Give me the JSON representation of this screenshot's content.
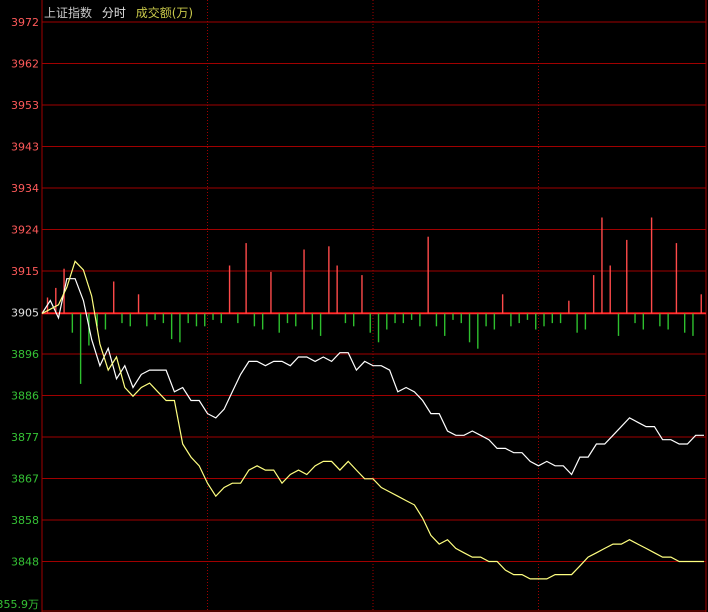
{
  "header": {
    "index_name": "上证指数",
    "chart_mode": "分时",
    "volume_label": "成交额(万)"
  },
  "colors": {
    "grid": "#a00000",
    "axis_label": "#ff5a5a",
    "axis_label_low": "#35c235",
    "price_line": "#ffffff",
    "avg_line": "#ffff80",
    "up_bar": "#ff4a4a",
    "down_bar": "#2ec02e",
    "title_text": "#c8c8c8",
    "volume_label_text": "#c9c94a"
  },
  "chart_data": {
    "type": "line",
    "title": "上证指数",
    "y_ticks": [
      "3972",
      "3962",
      "3953",
      "3943",
      "3934",
      "3924",
      "3915",
      "3905",
      "3896",
      "3886",
      "3877",
      "3867",
      "3858",
      "3848"
    ],
    "y_unit_label": "355.9万",
    "ylim": [
      3843.0,
      3974.0
    ],
    "reference_price": 3905,
    "x_range": [
      0,
      240
    ],
    "series": [
      {
        "key": "price",
        "x": [
          0,
          3,
          6,
          9,
          12,
          15,
          18,
          21,
          24,
          27,
          30,
          33,
          36,
          39,
          42,
          45,
          48,
          51,
          54,
          57,
          60,
          63,
          66,
          69,
          72,
          75,
          78,
          81,
          84,
          87,
          90,
          93,
          96,
          99,
          102,
          105,
          108,
          111,
          114,
          117,
          120,
          123,
          126,
          129,
          132,
          135,
          138,
          141,
          144,
          147,
          150,
          153,
          156,
          159,
          162,
          165,
          168,
          171,
          174,
          177,
          180,
          183,
          186,
          189,
          192,
          195,
          198,
          201,
          204,
          207,
          210,
          213,
          216,
          219,
          222,
          225,
          228,
          231,
          234,
          237,
          240
        ],
        "y": [
          3905,
          3908,
          3904,
          3913,
          3913,
          3908,
          3899,
          3893,
          3897,
          3890,
          3893,
          3888,
          3891,
          3892,
          3892,
          3892,
          3887,
          3888,
          3885,
          3885,
          3882,
          3881,
          3883,
          3887,
          3891,
          3894,
          3894,
          3893,
          3894,
          3894,
          3893,
          3895,
          3895,
          3894,
          3895,
          3894,
          3896,
          3896,
          3892,
          3894,
          3893,
          3893,
          3892,
          3887,
          3888,
          3887,
          3885,
          3882,
          3882,
          3878,
          3877,
          3877,
          3878,
          3877,
          3876,
          3874,
          3874,
          3873,
          3873,
          3871,
          3870,
          3871,
          3870,
          3870,
          3868,
          3872,
          3872,
          3875,
          3875,
          3877,
          3879,
          3881,
          3880,
          3879,
          3879,
          3876,
          3876,
          3875,
          3875,
          3877,
          3877
        ]
      },
      {
        "key": "average",
        "x": [
          0,
          3,
          6,
          9,
          12,
          15,
          18,
          21,
          24,
          27,
          30,
          33,
          36,
          39,
          42,
          45,
          48,
          51,
          54,
          57,
          60,
          63,
          66,
          69,
          72,
          75,
          78,
          81,
          84,
          87,
          90,
          93,
          96,
          99,
          102,
          105,
          108,
          111,
          114,
          117,
          120,
          123,
          126,
          129,
          132,
          135,
          138,
          141,
          144,
          147,
          150,
          153,
          156,
          159,
          162,
          165,
          168,
          171,
          174,
          177,
          180,
          183,
          186,
          189,
          192,
          195,
          198,
          201,
          204,
          207,
          210,
          213,
          216,
          219,
          222,
          225,
          228,
          231,
          234,
          237,
          240
        ],
        "y": [
          3905,
          3906,
          3907,
          3911,
          3917,
          3915,
          3909,
          3898,
          3892,
          3895,
          3888,
          3886,
          3888,
          3889,
          3887,
          3885,
          3885,
          3875,
          3872,
          3870,
          3866,
          3863,
          3865,
          3866,
          3866,
          3869,
          3870,
          3869,
          3869,
          3866,
          3868,
          3869,
          3868,
          3870,
          3871,
          3871,
          3869,
          3871,
          3869,
          3867,
          3867,
          3865,
          3864,
          3863,
          3862,
          3861,
          3858,
          3854,
          3852,
          3853,
          3851,
          3850,
          3849,
          3849,
          3848,
          3848,
          3846,
          3845,
          3845,
          3844,
          3844,
          3844,
          3845,
          3845,
          3845,
          3847,
          3849,
          3850,
          3851,
          3852,
          3852,
          3853,
          3852,
          3851,
          3850,
          3849,
          3849,
          3848,
          3848,
          3848,
          3848
        ]
      }
    ],
    "volume": {
      "x": [
        2,
        5,
        8,
        11,
        14,
        17,
        20,
        23,
        26,
        29,
        32,
        35,
        38,
        41,
        44,
        47,
        50,
        53,
        56,
        59,
        62,
        65,
        68,
        71,
        74,
        77,
        80,
        83,
        86,
        89,
        92,
        95,
        98,
        101,
        104,
        107,
        110,
        113,
        116,
        119,
        122,
        125,
        128,
        131,
        134,
        137,
        140,
        143,
        146,
        149,
        152,
        155,
        158,
        161,
        164,
        167,
        170,
        173,
        176,
        179,
        182,
        185,
        188,
        191,
        194,
        197,
        200,
        203,
        206,
        209,
        212,
        215,
        218,
        221,
        224,
        227,
        230,
        233,
        236,
        239
      ],
      "v": [
        5,
        8,
        14,
        -6,
        -22,
        -10,
        -4,
        -5,
        10,
        -3,
        -4,
        6,
        -4,
        -2,
        -3,
        -8,
        -9,
        -3,
        -4,
        -4,
        -2,
        -3,
        15,
        -3,
        22,
        -4,
        -5,
        13,
        -6,
        -3,
        -4,
        20,
        -5,
        -7,
        21,
        15,
        -3,
        -4,
        12,
        -6,
        -9,
        -5,
        -3,
        -3,
        -2,
        -4,
        24,
        -4,
        -7,
        -2,
        -3,
        -9,
        -11,
        -4,
        -5,
        6,
        -4,
        -3,
        -2,
        -5,
        -4,
        -3,
        -3,
        4,
        -6,
        -5,
        12,
        30,
        15,
        -7,
        23,
        -3,
        -5,
        30,
        -4,
        -5,
        22,
        -6,
        -7,
        6
      ]
    }
  }
}
